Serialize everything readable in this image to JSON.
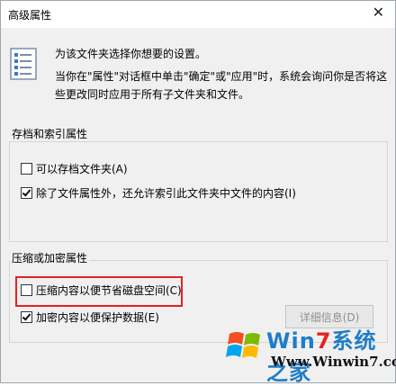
{
  "window": {
    "title": "高级属性",
    "close_glyph": "✕"
  },
  "info": {
    "line1": "为该文件夹选择你想要的设置。",
    "line2": "当你在\"属性\"对话框中单击\"确定\"或\"应用\"时，系统会询问你是否将这些更改同时应用于所有子文件夹和文件。"
  },
  "archive_group": {
    "label": "存档和索引属性",
    "options": [
      {
        "label": "可以存档文件夹(A)",
        "checked": false
      },
      {
        "label": "除了文件属性外，还允许索引此文件夹中文件的内容(I)",
        "checked": true
      }
    ]
  },
  "encrypt_group": {
    "label": "压缩或加密属性",
    "options": [
      {
        "label": "压缩内容以便节省磁盘空间(C)",
        "checked": false
      },
      {
        "label": "加密内容以便保护数据(E)",
        "checked": true
      }
    ],
    "details_button": "详细信息(D)"
  },
  "watermark": {
    "text_part1": "Win",
    "text_part2": "7",
    "text_part3": "系统之家",
    "url": "Www.Winwin7.com"
  },
  "colors": {
    "highlight": "#e32222",
    "background": "#f0f0f0"
  }
}
